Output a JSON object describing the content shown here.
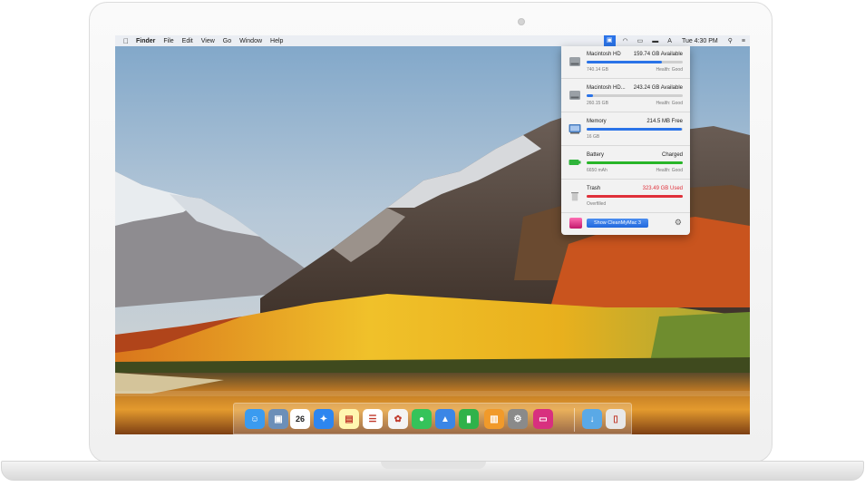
{
  "menubar": {
    "app_name": "Finder",
    "menus": [
      "File",
      "Edit",
      "View",
      "Go",
      "Window",
      "Help"
    ],
    "time": "Tue 4:30 PM",
    "icons": [
      "cleanmymac-menu-icon",
      "wifi-icon",
      "airplay-icon",
      "battery-icon",
      "user-icon",
      "spotlight-icon",
      "list-icon"
    ]
  },
  "popover": {
    "rows": [
      {
        "title": "Macintosh HD",
        "value": "159.74 GB Available",
        "sub": "740.14 GB",
        "sub_right": "Health: Good",
        "fill": 0.78,
        "color": "#2a73e8",
        "icon": "hard-drive-icon"
      },
      {
        "title": "Macintosh HD...",
        "value": "243.24 GB Available",
        "sub": "260.15 GB",
        "sub_right": "Health: Good",
        "fill": 0.07,
        "color": "#2a73e8",
        "icon": "hard-drive-icon"
      },
      {
        "title": "Memory",
        "value": "214.5 MB Free",
        "sub": "16 GB",
        "sub_right": "",
        "fill": 0.99,
        "color": "#2a73e8",
        "icon": "memory-icon"
      },
      {
        "title": "Battery",
        "value": "Charged",
        "sub": "6650 mAh",
        "sub_right": "Health: Good",
        "fill": 1.0,
        "color": "#28b528",
        "icon": "battery-icon"
      },
      {
        "title": "Trash",
        "value": "323.49 GB Used",
        "sub": "Overfilled",
        "sub_right": "",
        "fill": 1.0,
        "color": "#e0303a",
        "icon": "trash-icon"
      }
    ],
    "show_button": "Show CleanMyMac 3"
  },
  "dock": {
    "items": [
      {
        "name": "finder-icon",
        "color": "#3a9bf0",
        "glyph": "☺"
      },
      {
        "name": "preview-icon",
        "color": "#6c8fb8",
        "glyph": "▣"
      },
      {
        "name": "calendar-icon",
        "color": "#ffffff",
        "glyph": "26"
      },
      {
        "name": "safari-icon",
        "color": "#2d86f0",
        "glyph": "✦"
      },
      {
        "name": "notes-icon",
        "color": "#fff7b0",
        "glyph": "▤"
      },
      {
        "name": "reminders-icon",
        "color": "#ffffff",
        "glyph": "☰"
      },
      {
        "name": "photos-icon",
        "color": "#f4f4f4",
        "glyph": "✿"
      },
      {
        "name": "facetime-icon",
        "color": "#35c35a",
        "glyph": "●"
      },
      {
        "name": "keynote-icon",
        "color": "#3b86e6",
        "glyph": "▲"
      },
      {
        "name": "numbers-icon",
        "color": "#2fb24a",
        "glyph": "▮"
      },
      {
        "name": "ibooks-icon",
        "color": "#f19a2a",
        "glyph": "▥"
      },
      {
        "name": "system-preferences-icon",
        "color": "#8a8a8a",
        "glyph": "⚙"
      },
      {
        "name": "cleanmymac-icon",
        "color": "#d8307f",
        "glyph": "▭"
      },
      {
        "name": "downloads-folder-icon",
        "color": "#5aa9e6",
        "glyph": "↓"
      },
      {
        "name": "trash-icon",
        "color": "#e8e8e8",
        "glyph": "▯"
      }
    ]
  }
}
